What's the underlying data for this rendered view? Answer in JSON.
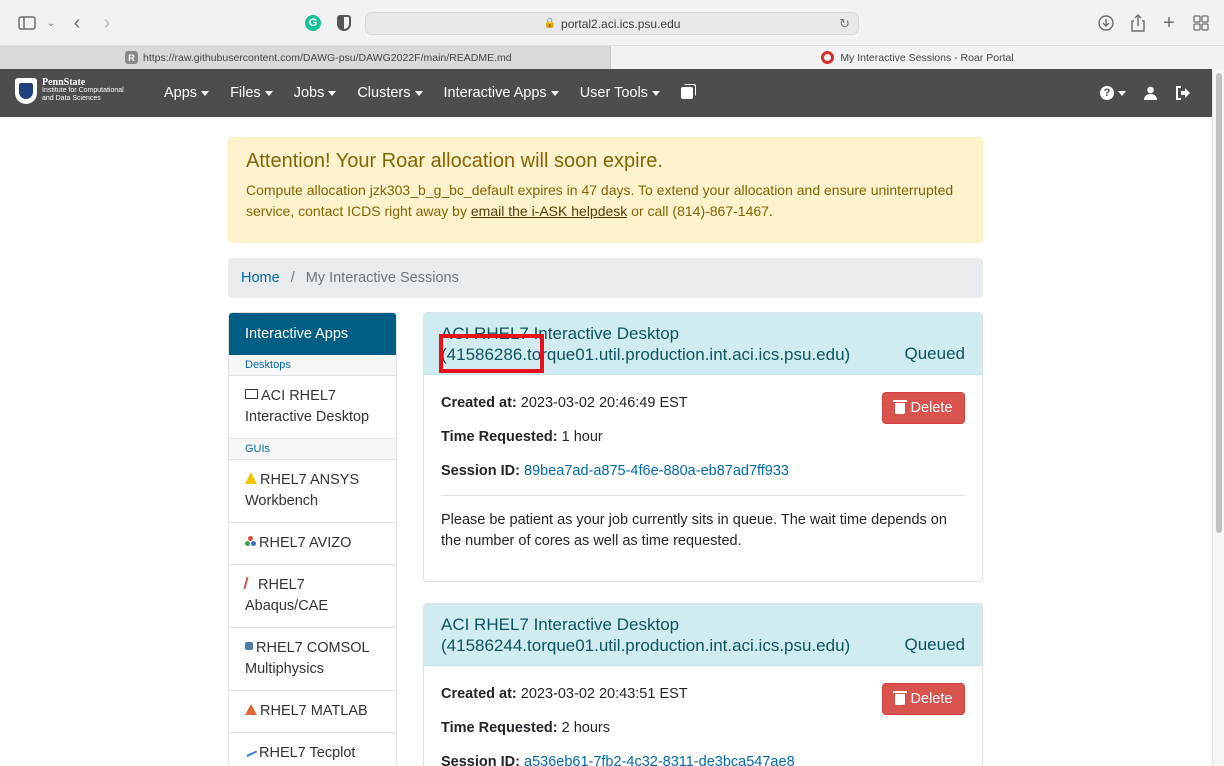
{
  "browser": {
    "url": "portal2.aci.ics.psu.edu",
    "tabs": [
      {
        "label": "https://raw.githubusercontent.com/DAWG-psu/DAWG2022F/main/README.md",
        "favicon": "R"
      },
      {
        "label": "My Interactive Sessions - Roar Portal"
      }
    ]
  },
  "navbar": {
    "logo_line1": "PennState",
    "logo_line2": "Institute for Computational",
    "logo_line3": "and Data Sciences",
    "items": [
      {
        "label": "Apps"
      },
      {
        "label": "Files"
      },
      {
        "label": "Jobs"
      },
      {
        "label": "Clusters"
      },
      {
        "label": "Interactive Apps"
      },
      {
        "label": "User Tools"
      }
    ]
  },
  "alert": {
    "title": "Attention! Your Roar allocation will soon expire.",
    "text_before": "Compute allocation jzk303_b_g_bc_default expires in 47 days. To extend your allocation and ensure uninterrupted service, contact ICDS right away by ",
    "link": "email the i-ASK helpdesk",
    "text_after": " or call (814)-867-1467."
  },
  "breadcrumb": {
    "home": "Home",
    "separator": "/",
    "current": "My Interactive Sessions"
  },
  "sidebar": {
    "header": "Interactive Apps",
    "desktops_label": "Desktops",
    "guis_label": "GUIs",
    "desktops": [
      {
        "label": "ACI RHEL7 Interactive Desktop"
      }
    ],
    "guis": [
      {
        "label": "RHEL7 ANSYS Workbench"
      },
      {
        "label": "RHEL7 AVIZO"
      },
      {
        "label": "RHEL7 Abaqus/CAE"
      },
      {
        "label": "RHEL7 COMSOL Multiphysics"
      },
      {
        "label": "RHEL7 MATLAB"
      },
      {
        "label": "RHEL7 Tecplot"
      }
    ]
  },
  "labels": {
    "created": "Created at:",
    "time_requested": "Time Requested:",
    "session_id": "Session ID:",
    "delete": "Delete"
  },
  "sessions": [
    {
      "title_line1": "ACI RHEL7 Interactive Desktop",
      "title_line2": "(41586286.torque01.util.production.int.aci.ics.psu.edu)",
      "status": "Queued",
      "created_at": "2023-03-02 20:46:49 EST",
      "time_requested": "1 hour",
      "session_id": "89bea7ad-a875-4f6e-880a-eb87ad7ff933",
      "message": "Please be patient as your job currently sits in queue. The wait time depends on the number of cores as well as time requested."
    },
    {
      "title_line1": "ACI RHEL7 Interactive Desktop",
      "title_line2": "(41586244.torque01.util.production.int.aci.ics.psu.edu)",
      "status": "Queued",
      "created_at": "2023-03-02 20:43:51 EST",
      "time_requested": "2 hours",
      "session_id": "a536eb61-7fb2-4c32-8311-de3bca547ae8"
    }
  ],
  "colors": {
    "navbar": "#4d4d4d",
    "alert_bg": "#fff3cd",
    "card_header": "#d1ecf1",
    "delete_button": "#d9534f",
    "highlight": "#e8111b"
  }
}
